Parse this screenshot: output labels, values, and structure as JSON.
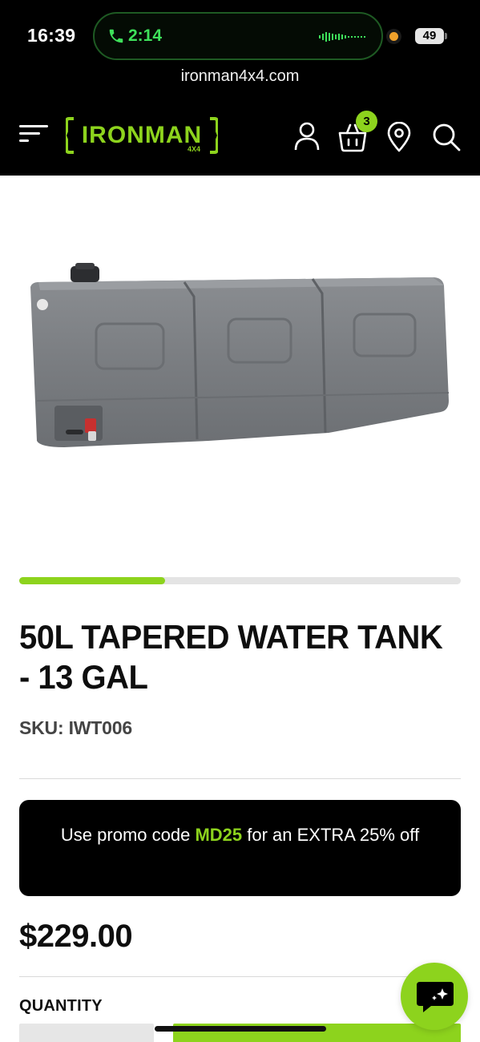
{
  "status_bar": {
    "time": "16:39",
    "call_duration": "2:14",
    "battery": "49"
  },
  "browser": {
    "url": "ironman4x4.com"
  },
  "header": {
    "logo_text": "IRONMAN 4X4",
    "cart_count": "3",
    "icons": [
      "menu-icon",
      "user-icon",
      "basket-icon",
      "location-icon",
      "search-icon"
    ]
  },
  "gallery": {
    "progress": 0.33
  },
  "product": {
    "title": "50L TAPERED WATER TANK - 13 GAL",
    "sku": "SKU: IWT006",
    "price": "$229.00"
  },
  "promo": {
    "text_before": "Use promo code ",
    "code": "MD25",
    "text_after": " for an EXTRA 25% off"
  },
  "quantity": {
    "label": "QUANTITY"
  },
  "colors": {
    "accent": "#8dd31d",
    "header_bg": "#000000",
    "call_green": "#3ee05a"
  }
}
